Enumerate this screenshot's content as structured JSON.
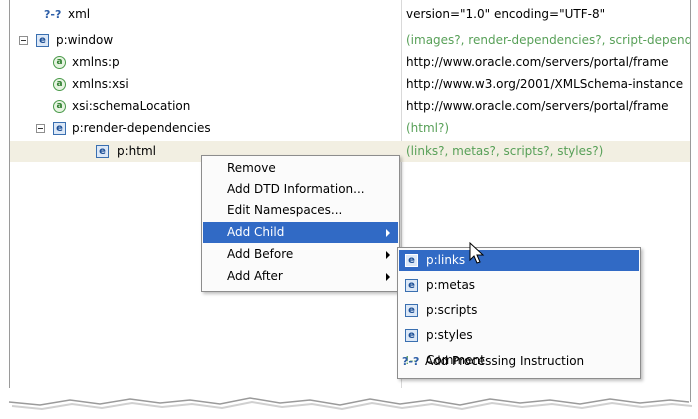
{
  "tree": {
    "rows": [
      {
        "label": "xml",
        "icon": "processing-instruction-icon",
        "icon_text": "?-?",
        "value": "version=\"1.0\" encoding=\"UTF-8\"",
        "value_style": "normal"
      },
      {
        "label": "p:window",
        "icon": "element-icon",
        "icon_text": "e",
        "value": "(images?, render-dependencies?, script-depend",
        "value_style": "content-model",
        "expander": true
      },
      {
        "label": "xmlns:p",
        "icon": "attribute-icon",
        "icon_text": "a",
        "value": "http://www.oracle.com/servers/portal/frame",
        "value_style": "normal"
      },
      {
        "label": "xmlns:xsi",
        "icon": "attribute-icon",
        "icon_text": "a",
        "value": "http://www.w3.org/2001/XMLSchema-instance",
        "value_style": "normal"
      },
      {
        "label": "xsi:schemaLocation",
        "icon": "attribute-icon",
        "icon_text": "a",
        "value": "http://www.oracle.com/servers/portal/frame",
        "value_style": "normal"
      },
      {
        "label": "p:render-dependencies",
        "icon": "element-icon",
        "icon_text": "e",
        "value": "(html?)",
        "value_style": "content-model",
        "expander": true
      },
      {
        "label": "p:html",
        "icon": "element-icon",
        "icon_text": "e",
        "value": "(links?, metas?, scripts?, styles?)",
        "value_style": "content-model",
        "selected": true
      }
    ]
  },
  "context_menu": {
    "items": [
      {
        "label": "Remove"
      },
      {
        "label": "Add DTD Information..."
      },
      {
        "label": "Edit Namespaces..."
      },
      {
        "label": "Add Child",
        "submenu": true,
        "active": true
      },
      {
        "label": "Add Before",
        "submenu": true
      },
      {
        "label": "Add After",
        "submenu": true
      }
    ]
  },
  "submenu": {
    "items": [
      {
        "label": "p:links",
        "icon": "element-icon",
        "icon_text": "e",
        "active": true
      },
      {
        "label": "p:metas",
        "icon": "element-icon",
        "icon_text": "e"
      },
      {
        "label": "p:scripts",
        "icon": "element-icon",
        "icon_text": "e"
      },
      {
        "label": "p:styles",
        "icon": "element-icon",
        "icon_text": "e"
      },
      {
        "label": "Comment",
        "icon": "comment-icon",
        "icon_text": "!--"
      },
      {
        "label": "Add Processing Instruction",
        "icon": "processing-instruction-icon",
        "icon_text": "?-?"
      }
    ]
  },
  "colors": {
    "selection": "#316ac5",
    "row_selected": "#f2efe2",
    "content_model_text": "#58a058",
    "element_icon": "#1d4f96",
    "attribute_icon": "#2f7f2f"
  }
}
